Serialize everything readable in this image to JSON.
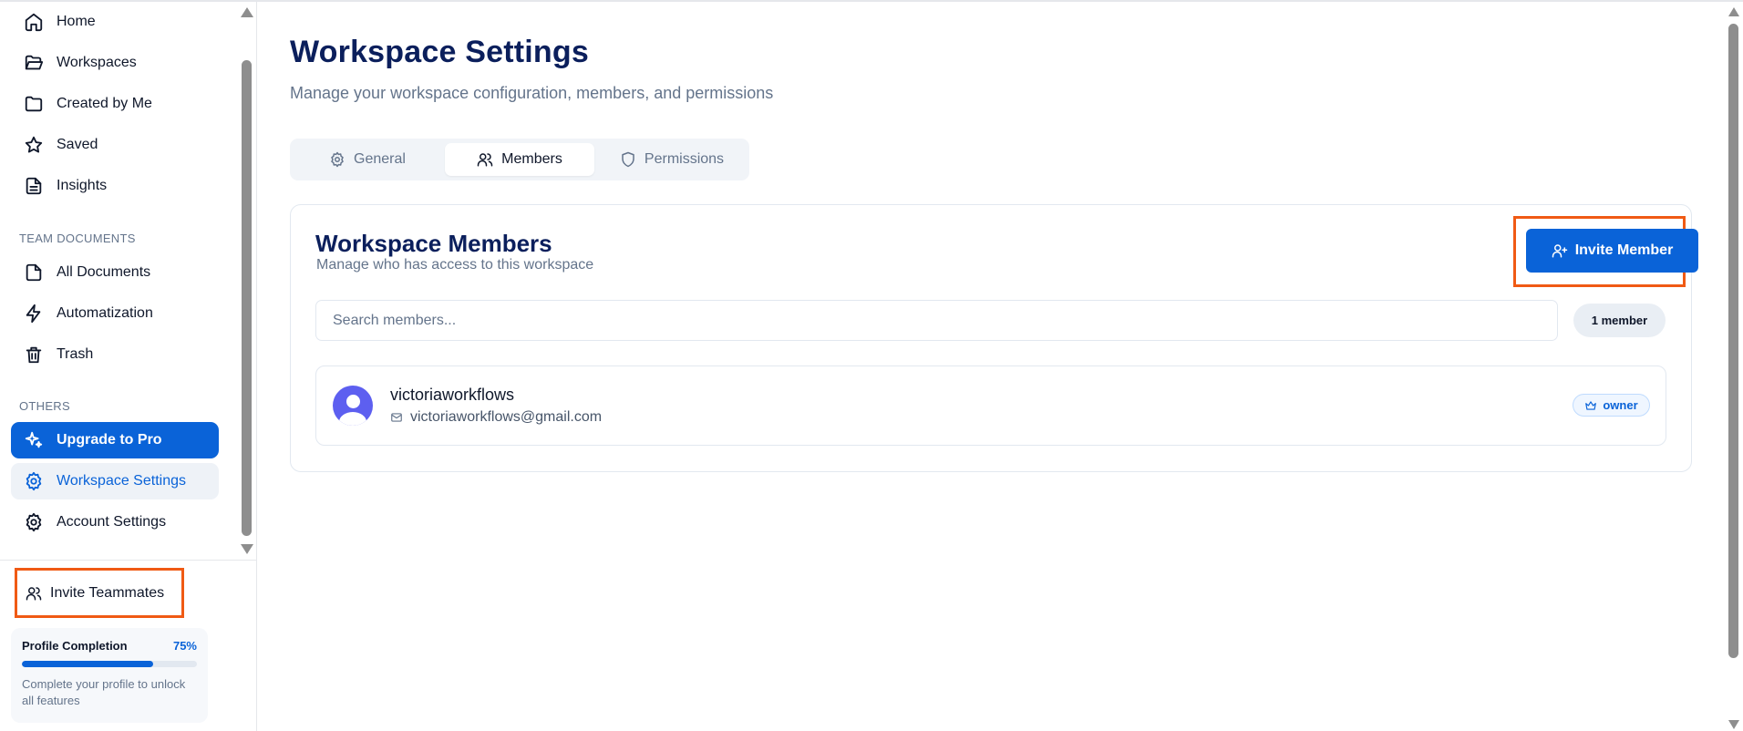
{
  "sidebar": {
    "nav": [
      {
        "label": "Home",
        "icon": "home-icon"
      },
      {
        "label": "Workspaces",
        "icon": "folder-open-icon"
      },
      {
        "label": "Created by Me",
        "icon": "folder-icon"
      },
      {
        "label": "Saved",
        "icon": "star-icon"
      },
      {
        "label": "Insights",
        "icon": "file-text-icon"
      }
    ],
    "team_label": "TEAM DOCUMENTS",
    "team": [
      {
        "label": "All Documents",
        "icon": "file-icon"
      },
      {
        "label": "Automatization",
        "icon": "bolt-icon"
      },
      {
        "label": "Trash",
        "icon": "trash-icon"
      }
    ],
    "others_label": "OTHERS",
    "others": [
      {
        "label": "Upgrade to Pro",
        "icon": "sparkles-icon"
      },
      {
        "label": "Workspace Settings",
        "icon": "gear-icon"
      },
      {
        "label": "Account Settings",
        "icon": "gear-icon"
      }
    ],
    "invite_label": "Invite Teammates",
    "profile": {
      "title": "Profile Completion",
      "percent_label": "75%",
      "progress": 0.75,
      "description": "Complete your profile to unlock all features"
    }
  },
  "main": {
    "title": "Workspace Settings",
    "subtitle": "Manage your workspace configuration, members, and permissions",
    "tabs": [
      {
        "label": "General",
        "icon": "gear-icon"
      },
      {
        "label": "Members",
        "icon": "users-icon",
        "active": true
      },
      {
        "label": "Permissions",
        "icon": "shield-icon"
      }
    ],
    "members_card": {
      "title": "Workspace Members",
      "subtitle": "Manage who has access to this workspace",
      "invite_label": "Invite Member",
      "search_placeholder": "Search members...",
      "count_label": "1 member",
      "members": [
        {
          "name": "victoriaworkflows",
          "email": "victoriaworkflows@gmail.com",
          "role": "owner"
        }
      ]
    }
  },
  "colors": {
    "accent": "#0a63d8",
    "highlight": "#f05a14",
    "title": "#0b1f5c"
  }
}
